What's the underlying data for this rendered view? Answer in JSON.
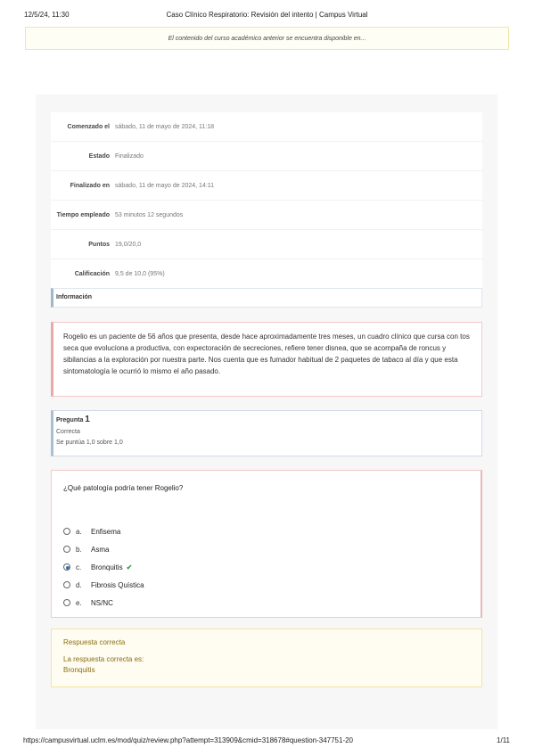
{
  "print_header": {
    "date": "12/5/24, 11:30",
    "title": "Caso Clínico Respiratorio: Revisión del intento | Campus Virtual"
  },
  "notice": "El contenido del curso académico anterior se encuentra disponible en...",
  "summary": [
    {
      "label": "Comenzado el",
      "value": "sábado, 11 de mayo de 2024, 11:18"
    },
    {
      "label": "Estado",
      "value": "Finalizado"
    },
    {
      "label": "Finalizado en",
      "value": "sábado, 11 de mayo de 2024, 14:11"
    },
    {
      "label": "Tiempo empleado",
      "value": "53 minutos 12 segundos"
    },
    {
      "label": "Puntos",
      "value": "19,0/20,0"
    },
    {
      "label": "Calificación",
      "value": "9,5 de 10,0 (95%)"
    }
  ],
  "info": {
    "heading": "Información",
    "text": "Rogelio es un paciente de 56 años que presenta, desde hace aproximadamente tres meses, un cuadro clínico que cursa con tos seca que evoluciona a productiva, con expectoración de secreciones, refiere tener disnea, que se acompaña de roncus y sibilancias a la exploración por nuestra parte. Nos cuenta que es fumador habitual de 2 paquetes de tabaco al día y que esta sintomatología le ocurrió lo mismo el año pasado."
  },
  "question": {
    "label": "Pregunta",
    "number": "1",
    "status": "Correcta",
    "score": "Se puntúa 1,0 sobre 1,0",
    "text": "¿Qué patología podría tener Rogelio?",
    "options": [
      {
        "letter": "a.",
        "text": "Enfisema",
        "selected": false,
        "correct": false
      },
      {
        "letter": "b.",
        "text": "Asma",
        "selected": false,
        "correct": false
      },
      {
        "letter": "c.",
        "text": "Bronquitis",
        "selected": true,
        "correct": true
      },
      {
        "letter": "d.",
        "text": "Fibrosis Quística",
        "selected": false,
        "correct": false
      },
      {
        "letter": "e.",
        "text": "NS/NC",
        "selected": false,
        "correct": false
      }
    ]
  },
  "feedback": {
    "title": "Respuesta correcta",
    "intro": "La respuesta correcta es:",
    "answer": "Bronquitis"
  },
  "print_footer": {
    "url": "https://campusvirtual.uclm.es/mod/quiz/review.php?attempt=313909&cmid=318678#question-347751-20",
    "page": "1/11"
  },
  "colors": {
    "correct_check": "#3a9b4a",
    "feedback_text": "#8a6d12",
    "radio_selected": "#3a6fb0"
  }
}
